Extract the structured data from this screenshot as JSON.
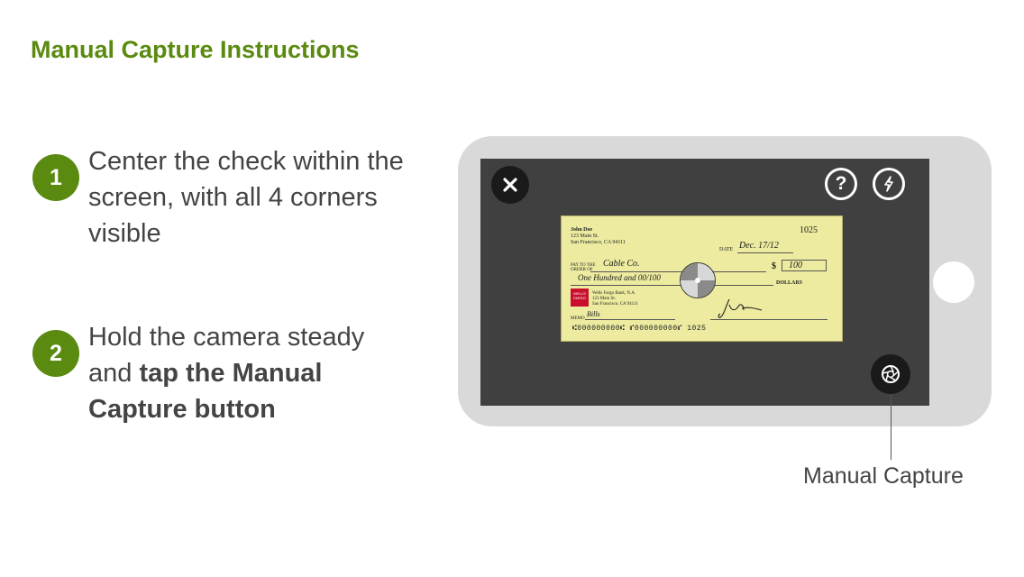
{
  "page": {
    "title": "Manual Capture Instructions"
  },
  "steps": [
    {
      "number": "1",
      "text": "Center the check within the screen, with all 4 corners visible"
    },
    {
      "number": "2",
      "text_plain": "Hold the camera steady and ",
      "text_bold": "tap the Manual Capture button"
    }
  ],
  "camera": {
    "close_icon": "close-icon",
    "help_icon": "question-mark-icon",
    "help_glyph": "?",
    "flash_icon": "flash-icon",
    "shutter_icon": "shutter-icon"
  },
  "check": {
    "payer_name": "John Doe",
    "payer_address1": "123 Main St.",
    "payer_address2": "San Francisco, CA 94111",
    "check_number": "1025",
    "date_label": "DATE",
    "date_value": "Dec. 17/12",
    "pay_to_label1": "PAY TO THE",
    "pay_to_label2": "ORDER OF",
    "payee": "Cable Co.",
    "dollar_sign": "$",
    "amount": "100",
    "written_amount": "One Hundred and 00/100",
    "dollars_label": "DOLLARS",
    "bank_logo_text": "WELLS FARGO",
    "bank_name": "Wells Fargo Bank, N.A.",
    "bank_address1": "123 Main St.",
    "bank_address2": "San Francisco, CA 94111",
    "memo_label": "MEMO",
    "memo_value": "Bills",
    "micr_line": "⑆000000000⑆ ⑈000000000⑈ 1025"
  },
  "callout": {
    "label": "Manual Capture"
  },
  "colors": {
    "accent": "#5a8a10",
    "text": "#444444",
    "phone_body": "#d9d9d9",
    "screen": "#404040"
  }
}
